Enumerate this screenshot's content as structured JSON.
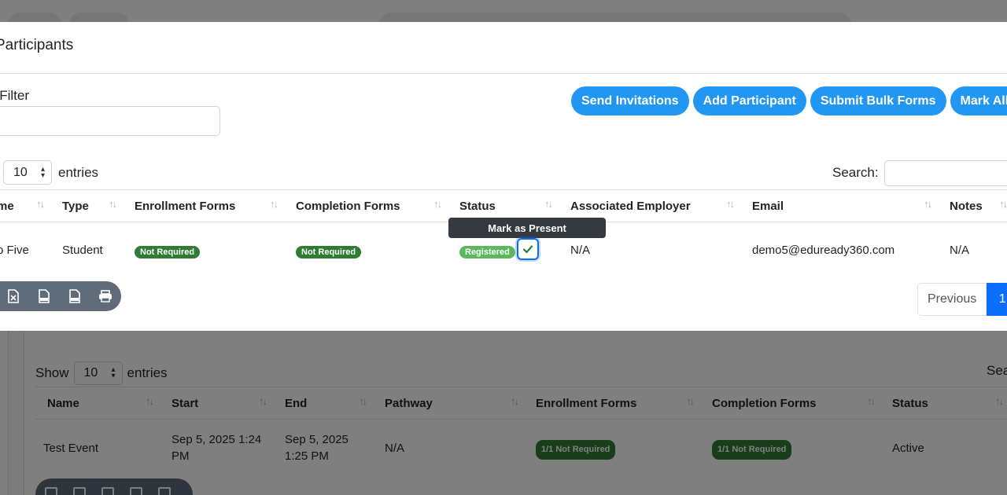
{
  "modal": {
    "title": "Participants",
    "filter_label": "s Filter",
    "buttons": [
      "Send Invitations",
      "Add Participant",
      "Submit Bulk Forms",
      "Mark All P"
    ],
    "length_value": "10",
    "entries_label": "entries",
    "search_label": "Search:",
    "columns": [
      "me",
      "Type",
      "Enrollment Forms",
      "Completion Forms",
      "Status",
      "Associated Employer",
      "Email",
      "Notes"
    ],
    "rows": [
      {
        "name": "o Five",
        "type": "Student",
        "enrollment": "Not Required",
        "completion": "Not Required",
        "status": "Registered",
        "employer": "N/A",
        "email": "demo5@eduready360.com",
        "notes": "N/A"
      }
    ],
    "tooltip": "Mark as Present",
    "export_icons": [
      "excel-icon",
      "csv-icon",
      "pdf-icon",
      "print-icon"
    ],
    "pager": {
      "previous": "Previous",
      "current": "1"
    }
  },
  "background": {
    "show_label": "Show",
    "length_value": "10",
    "entries_label": "entries",
    "search_label": "Sea",
    "columns": [
      "Name",
      "Start",
      "End",
      "Pathway",
      "Enrollment Forms",
      "Completion Forms",
      "Status"
    ],
    "rows": [
      {
        "name": "Test Event",
        "start": "Sep 5, 2025 1:24 PM",
        "end": "Sep 5, 2025 1:25 PM",
        "pathway": "N/A",
        "enrollment": "1/1 Not Required",
        "completion": "1/1 Not Required",
        "status": "Active"
      }
    ]
  },
  "colors": {
    "primary": "#2196f3",
    "page_active": "#0d6efd",
    "badge_dark": "#2f7d32",
    "badge_light": "#5cb85c",
    "tooltip": "#343a40",
    "toolbar": "#5f6b78"
  }
}
